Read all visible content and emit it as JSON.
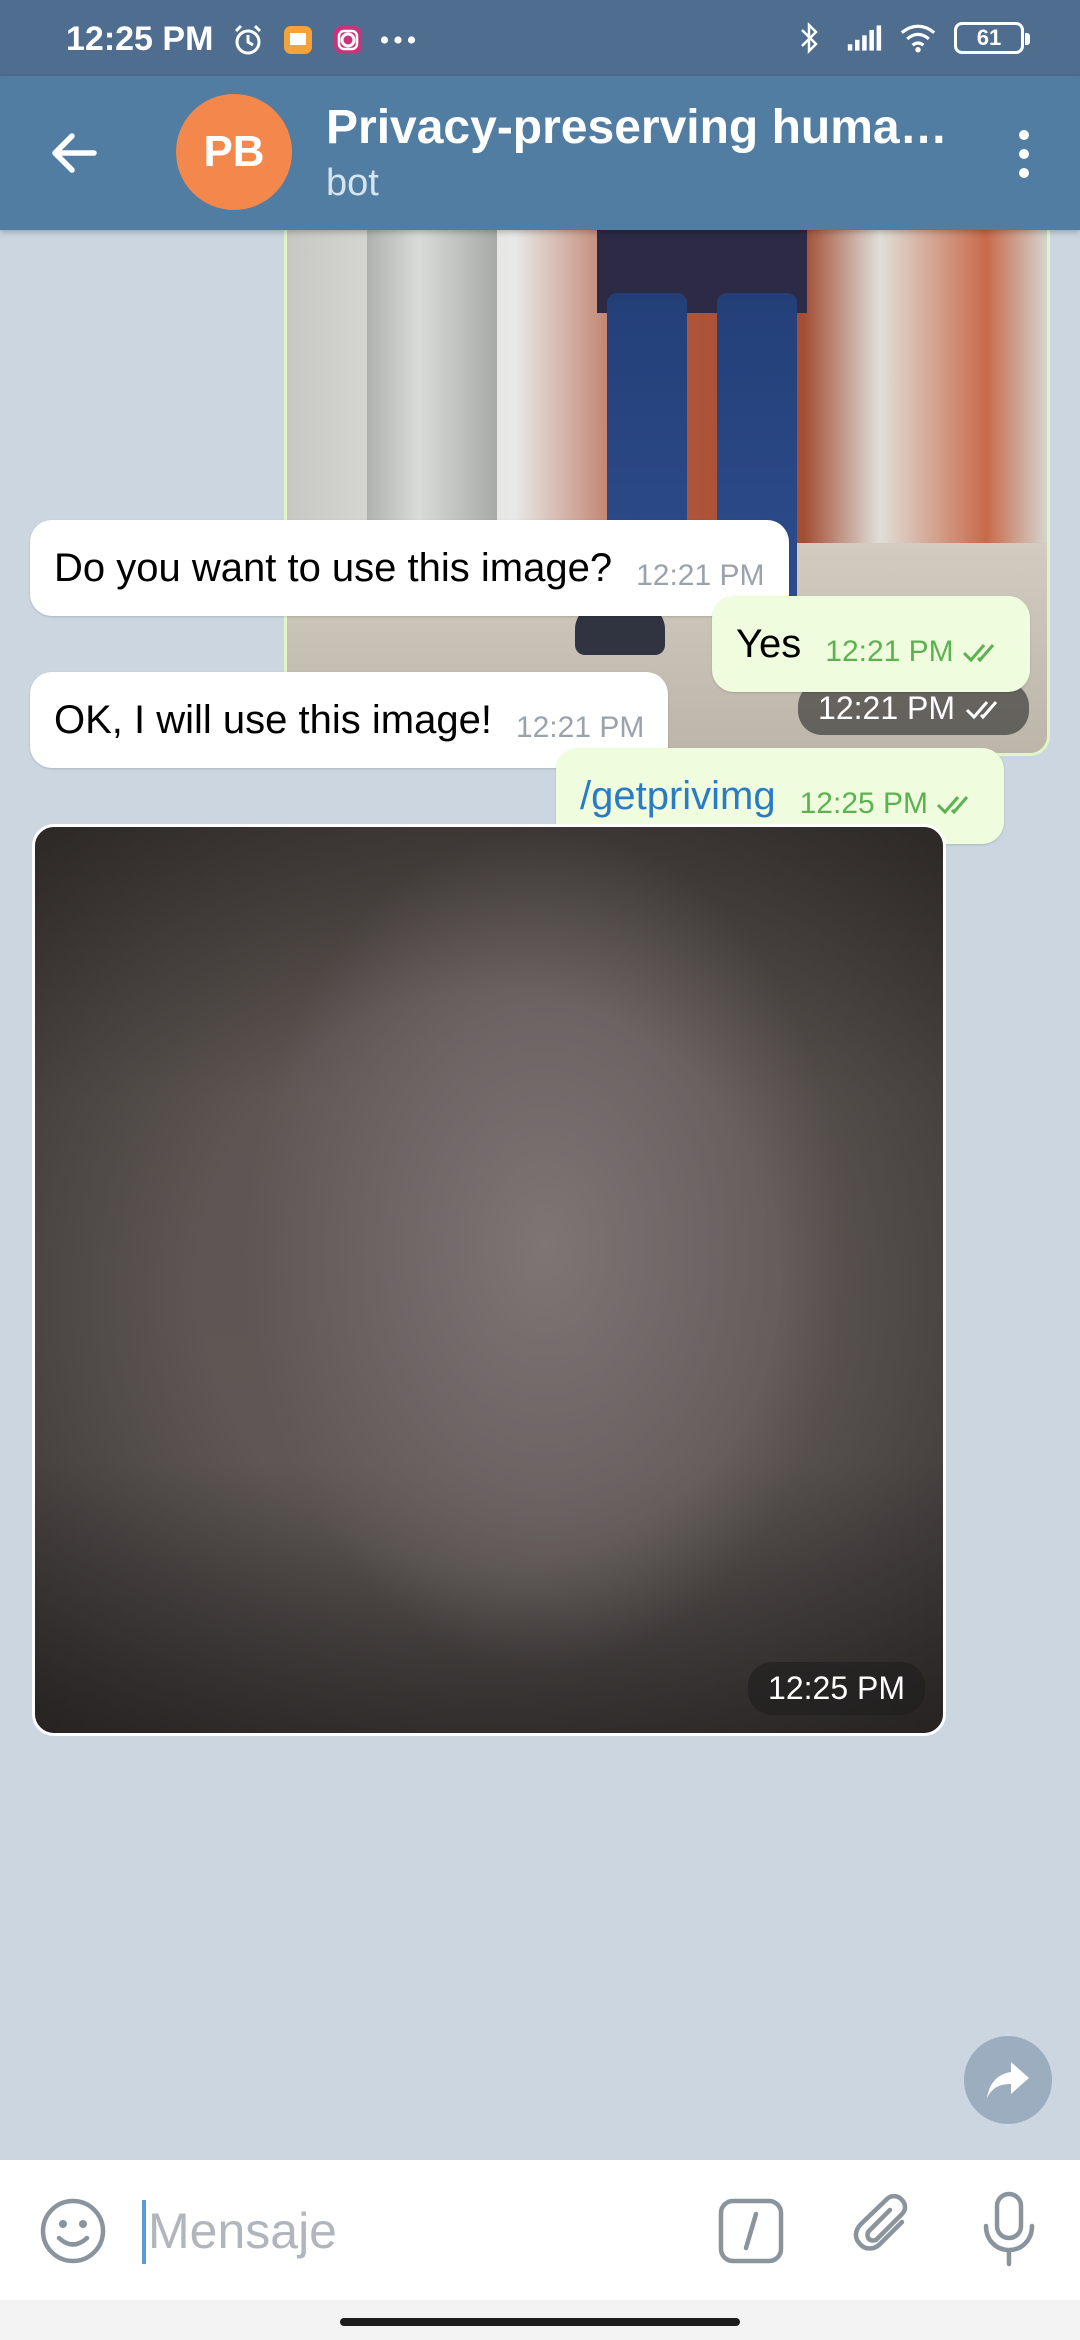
{
  "status_bar": {
    "time": "12:25 PM",
    "left_icons": [
      "alarm-icon",
      "notes-app-icon",
      "instagram-icon",
      "more-dots-icon"
    ],
    "right_icons": [
      "bluetooth-icon",
      "signal-icon",
      "wifi-icon"
    ],
    "battery": "61"
  },
  "header": {
    "avatar_initials": "PB",
    "avatar_color": "#f4874b",
    "title": "Privacy-preserving human…",
    "subtitle": "bot"
  },
  "messages": [
    {
      "type": "photo",
      "direction": "out",
      "time": "12:21 PM",
      "status": "read"
    },
    {
      "type": "text",
      "direction": "in",
      "text": "Do you want to use this image?",
      "time": "12:21 PM"
    },
    {
      "type": "text",
      "direction": "out",
      "text": "Yes",
      "time": "12:21 PM",
      "status": "read"
    },
    {
      "type": "text",
      "direction": "in",
      "text": "OK, I will use this image!",
      "time": "12:21 PM"
    },
    {
      "type": "command",
      "direction": "out",
      "text": "/getprivimg",
      "time": "12:25 PM",
      "status": "read"
    },
    {
      "type": "photo",
      "direction": "in",
      "time": "12:25 PM"
    }
  ],
  "input": {
    "placeholder": "Mensaje"
  },
  "colors": {
    "header": "#517da2",
    "status_bar": "#4f6e8f",
    "chat_bg": "#ccd6e0",
    "out_bubble": "#effdde",
    "in_bubble": "#ffffff",
    "read_check": "#5cb250",
    "command_link": "#2a7bc6"
  }
}
